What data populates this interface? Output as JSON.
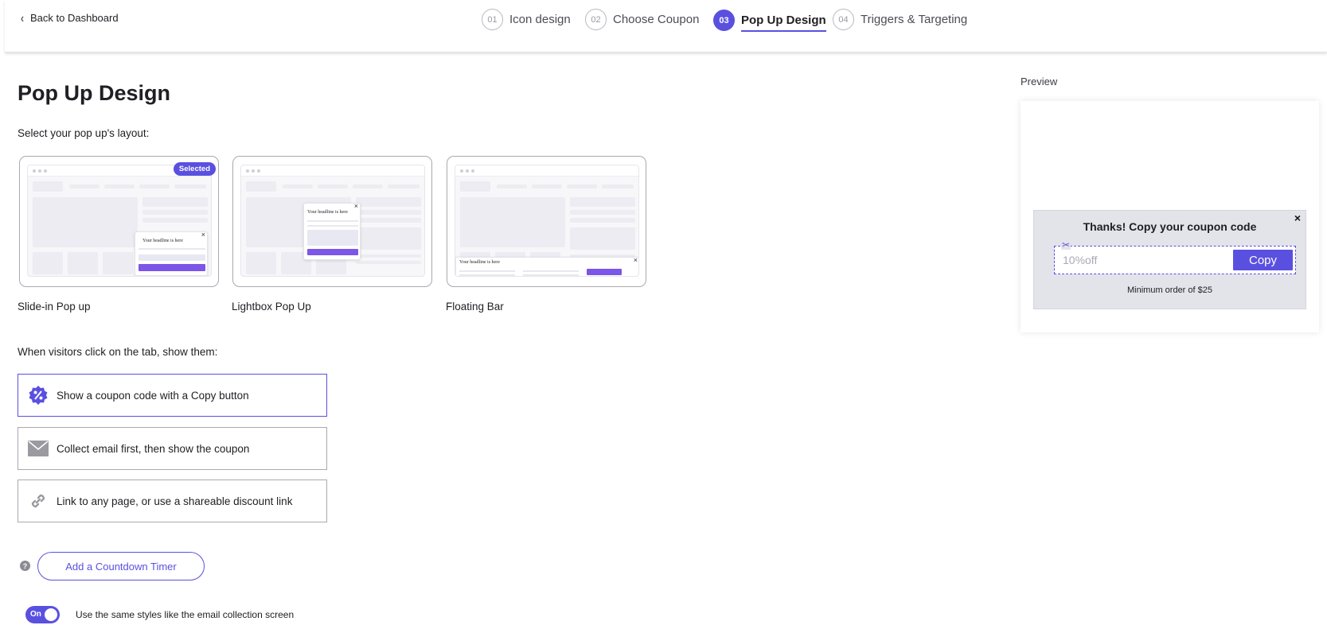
{
  "header": {
    "back_label": "Back to Dashboard",
    "steps": [
      {
        "num": "01",
        "label": "Icon design"
      },
      {
        "num": "02",
        "label": "Choose Coupon"
      },
      {
        "num": "03",
        "label": "Pop Up Design"
      },
      {
        "num": "04",
        "label": "Triggers & Targeting"
      }
    ],
    "active_step": "03"
  },
  "main": {
    "title": "Pop Up Design",
    "layout_prompt": "Select your pop up's layout:",
    "selected_badge": "Selected",
    "layouts": [
      {
        "label": "Slide-in Pop up",
        "mock_headline": "Your headline is here",
        "selected": true
      },
      {
        "label": "Lightbox Pop Up",
        "mock_headline": "Your headline is here",
        "selected": false
      },
      {
        "label": "Floating Bar",
        "mock_headline": "Your headline is here",
        "selected": false
      }
    ],
    "visitors_prompt": "When visitors click on the tab, show them:",
    "options": [
      {
        "label": "Show a coupon code with a Copy button",
        "icon": "percent-badge-icon",
        "selected": true
      },
      {
        "label": "Collect email first, then show the coupon",
        "icon": "envelope-icon",
        "selected": false
      },
      {
        "label": "Link to any page, or use a shareable discount link",
        "icon": "link-icon",
        "selected": false
      }
    ],
    "help_glyph": "?",
    "countdown_label": "Add a Countdown Timer",
    "toggle_state": "On",
    "toggle_label": "Use the same styles like the email collection screen"
  },
  "preview": {
    "label": "Preview",
    "headline": "Thanks! Copy your coupon code",
    "code": "10%off",
    "copy_label": "Copy",
    "min_order": "Minimum order of $25",
    "close_glyph": "×"
  },
  "colors": {
    "accent": "#5a50e0",
    "button_purple": "#7b56e8",
    "preview_bg": "#e2e4ea"
  }
}
